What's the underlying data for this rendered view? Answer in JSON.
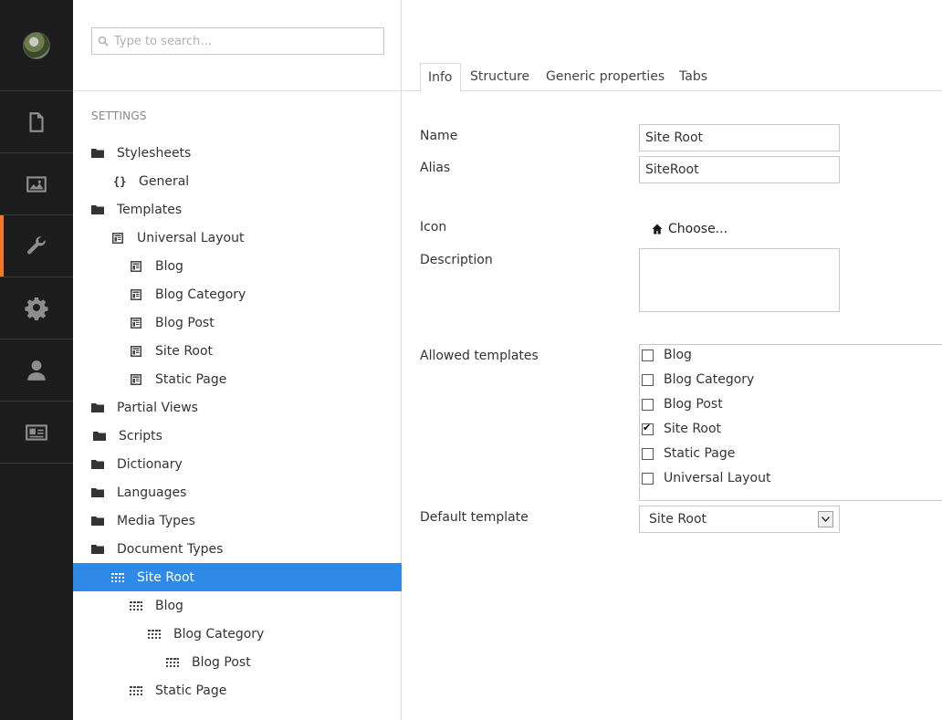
{
  "sidebar": {
    "sections": [
      {
        "icon": "document-icon",
        "active": false
      },
      {
        "icon": "image-icon",
        "active": false
      },
      {
        "icon": "wrench-icon",
        "active": true
      },
      {
        "icon": "gear-icon",
        "active": false
      },
      {
        "icon": "user-icon",
        "active": false
      },
      {
        "icon": "member-card-icon",
        "active": false
      }
    ],
    "accent": "#f5792a"
  },
  "tree": {
    "search_placeholder": "Type to search...",
    "section_title": "SETTINGS",
    "nodes": [
      {
        "label": "Stylesheets",
        "icon": "folder-icon",
        "level": 0
      },
      {
        "label": "General",
        "icon": "curly-braces-icon",
        "level": 1
      },
      {
        "label": "Templates",
        "icon": "folder-icon",
        "level": 0
      },
      {
        "label": "Universal Layout",
        "icon": "template-icon",
        "level": 1
      },
      {
        "label": "Blog",
        "icon": "template-icon",
        "level": 2
      },
      {
        "label": "Blog Category",
        "icon": "template-icon",
        "level": 2
      },
      {
        "label": "Blog Post",
        "icon": "template-icon",
        "level": 2
      },
      {
        "label": "Site Root",
        "icon": "template-icon",
        "level": 2
      },
      {
        "label": "Static Page",
        "icon": "template-icon",
        "level": 2
      },
      {
        "label": "Partial Views",
        "icon": "folder-icon",
        "level": 0
      },
      {
        "label": "Scripts",
        "icon": "folder-icon",
        "level": 0
      },
      {
        "label": "Dictionary",
        "icon": "folder-icon",
        "level": 0
      },
      {
        "label": "Languages",
        "icon": "folder-icon",
        "level": 0
      },
      {
        "label": "Media Types",
        "icon": "folder-icon",
        "level": 0
      },
      {
        "label": "Document Types",
        "icon": "folder-icon",
        "level": 0
      },
      {
        "label": "Site Root",
        "icon": "doctype-icon",
        "level": 1,
        "selected": true
      },
      {
        "label": "Blog",
        "icon": "doctype-icon",
        "level": 2
      },
      {
        "label": "Blog Category",
        "icon": "doctype-icon",
        "level": 3
      },
      {
        "label": "Blog Post",
        "icon": "doctype-icon",
        "level": 4
      },
      {
        "label": "Static Page",
        "icon": "doctype-icon",
        "level": 2
      }
    ],
    "selected_color": "#2e8ae6"
  },
  "tabs": [
    "Info",
    "Structure",
    "Generic properties",
    "Tabs"
  ],
  "form": {
    "name_label": "Name",
    "name_value": "Site Root",
    "alias_label": "Alias",
    "alias_value": "SiteRoot",
    "icon_label": "Icon",
    "icon_choose": "Choose...",
    "description_label": "Description",
    "description_value": "",
    "allowed_label": "Allowed templates",
    "allowed": [
      {
        "label": "Blog",
        "checked": false
      },
      {
        "label": "Blog Category",
        "checked": false
      },
      {
        "label": "Blog Post",
        "checked": false
      },
      {
        "label": "Site Root",
        "checked": true
      },
      {
        "label": "Static Page",
        "checked": false
      },
      {
        "label": "Universal Layout",
        "checked": false
      }
    ],
    "default_label": "Default template",
    "default_value": "Site Root"
  }
}
